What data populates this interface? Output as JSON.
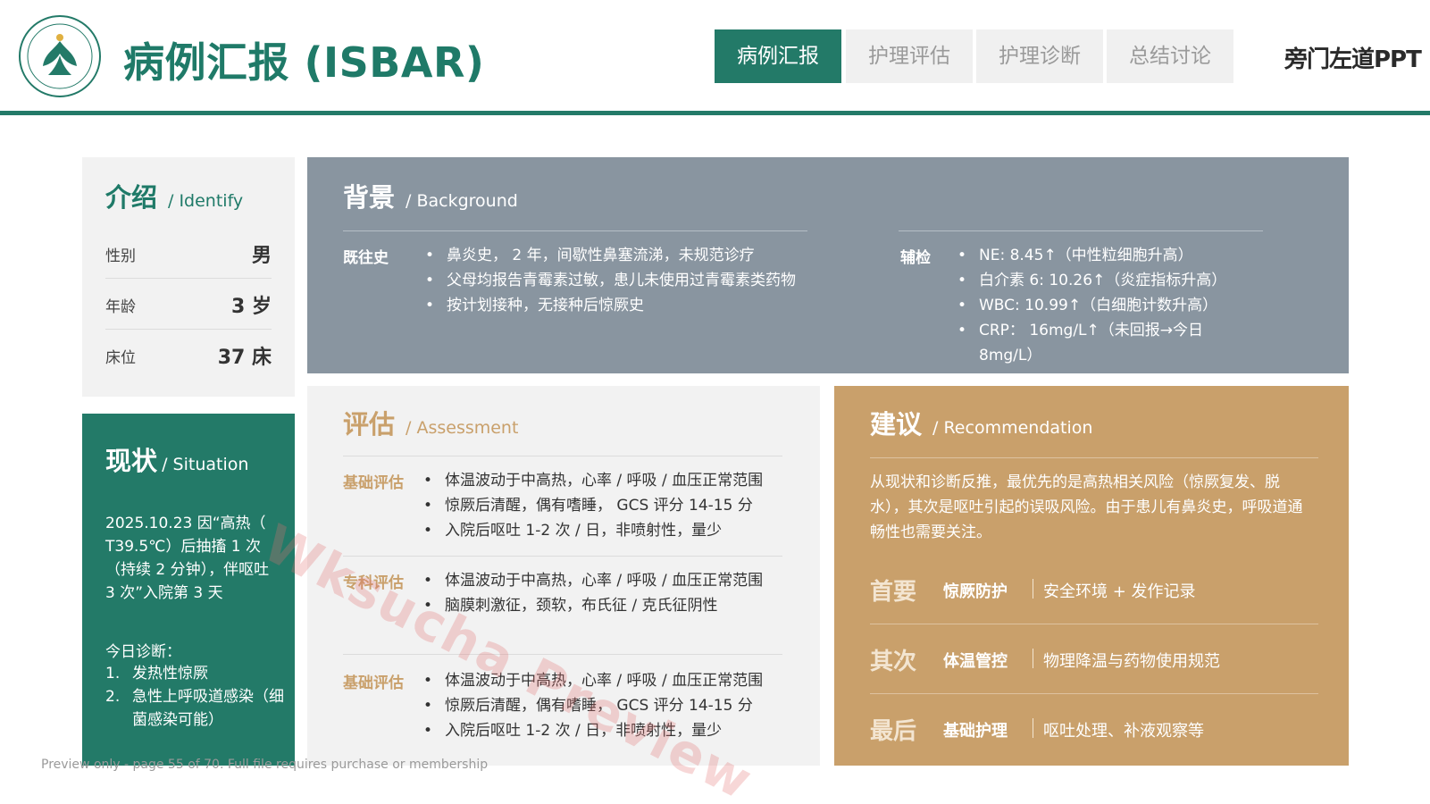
{
  "header": {
    "title": "病例汇报 (ISBAR)",
    "tabs": [
      {
        "label": "病例汇报",
        "active": true
      },
      {
        "label": "护理评估",
        "active": false
      },
      {
        "label": "护理诊断",
        "active": false
      },
      {
        "label": "总结讨论",
        "active": false
      }
    ],
    "brand": "旁门左道PPT",
    "logo_icon": "hospital-emblem-icon"
  },
  "identify": {
    "title_zh": "介绍",
    "title_en": "/ Identify",
    "rows": [
      {
        "label": "性别",
        "value": "男"
      },
      {
        "label": "年龄",
        "value": "3 岁"
      },
      {
        "label": "床位",
        "value": "37 床"
      }
    ]
  },
  "background": {
    "title_zh": "背景",
    "title_en": "/ Background",
    "history_label": "既往史",
    "history_items": [
      "鼻炎史， 2 年，间歇性鼻塞流涕，未规范诊疗",
      " 父母均报告青霉素过敏，患儿未使用过青霉素类药物",
      "按计划接种，无接种后惊厥史"
    ],
    "labs_label": "辅检",
    "labs_items": [
      "NE: 8.45↑（中性粒细胞升高）",
      "白介素 6: 10.26↑（炎症指标升高）",
      "WBC: 10.99↑（白细胞计数升高）",
      "CRP： 16mg/L↑（未回报→今日 8mg/L）"
    ]
  },
  "situation": {
    "title_zh": "现状",
    "title_en": "/ Situation",
    "text": "2025.10.23 因“高热（ T39.5℃）后抽搐 1 次（持续 2 分钟），伴呕吐 3 次”入院第 3 天",
    "dx_title": "今日诊断：",
    "diagnoses": [
      {
        "num": "1.",
        "text": "发热性惊厥"
      },
      {
        "num": "2.",
        "text": "急性上呼吸道感染（细菌感染可能）"
      }
    ]
  },
  "assessment": {
    "title_zh": "评估",
    "title_en": "/ Assessment",
    "sections": [
      {
        "label": "基础评估",
        "items": [
          "体温波动于中高热，心率 / 呼吸 / 血压正常范围",
          "惊厥后清醒，偶有嗜睡， GCS 评分 14-15 分",
          "入院后呕吐 1-2 次 / 日，非喷射性，量少"
        ]
      },
      {
        "label": "专科评估",
        "items": [
          "体温波动于中高热，心率 / 呼吸 / 血压正常范围",
          "脑膜刺激征，颈软，布氏征 / 克氏征阴性"
        ]
      },
      {
        "label": "基础评估",
        "items": [
          "体温波动于中高热，心率 / 呼吸 / 血压正常范围",
          "惊厥后清醒，偶有嗜睡， GCS 评分 14-15 分",
          "入院后呕吐 1-2 次 / 日，非喷射性，量少"
        ]
      }
    ]
  },
  "recommendation": {
    "title_zh": "建议",
    "title_en": "/ Recommendation",
    "intro": "从现状和诊断反推，最优先的是高热相关风险（惊厥复发、脱水），其次是呕吐引起的误吸风险。由于患儿有鼻炎史，呼吸道通畅性也需要关注。",
    "priorities": [
      {
        "level": "首要",
        "keyword": "惊厥防护",
        "desc": "安全环境 + 发作记录"
      },
      {
        "level": "其次",
        "keyword": "体温管控",
        "desc": "物理降温与药物使用规范"
      },
      {
        "level": "最后",
        "keyword": "基础护理",
        "desc": "呕吐处理、补液观察等"
      }
    ]
  },
  "footer": {
    "preview_note": "Preview only - page 55 of 70. Full file requires purchase or membership",
    "watermark": "Wksucha Preview"
  },
  "colors": {
    "primary_green": "#237a68",
    "gray_blue": "#8995a0",
    "tan": "#c9a06b",
    "light_gray": "#f2f2f2"
  }
}
